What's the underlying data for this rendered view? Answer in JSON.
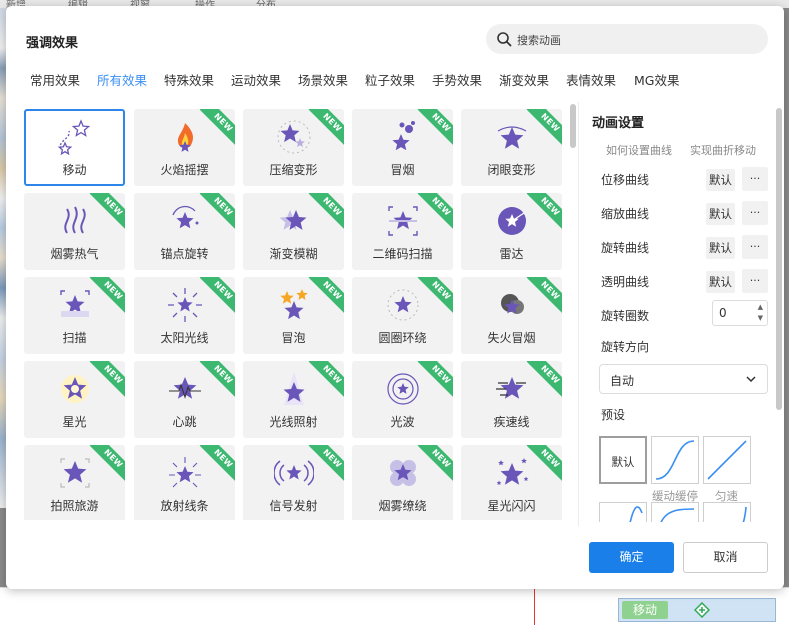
{
  "background_app": {
    "top_labels": [
      "新增",
      "编辑",
      "视窗",
      "操作",
      "分布"
    ],
    "track_clip_label": "移动"
  },
  "dialog": {
    "title": "强调效果",
    "search_placeholder": "搜索动画",
    "tabs": [
      "常用效果",
      "所有效果",
      "特殊效果",
      "运动效果",
      "场景效果",
      "粒子效果",
      "手势效果",
      "渐变效果",
      "表情效果",
      "MG效果"
    ],
    "active_tab": "所有效果",
    "effects": [
      {
        "label": "移动",
        "icon": "move-path-icon",
        "new": false,
        "selected": true
      },
      {
        "label": "火焰摇摆",
        "icon": "flame-icon",
        "new": true
      },
      {
        "label": "压缩变形",
        "icon": "compress-star-icon",
        "new": true
      },
      {
        "label": "冒烟",
        "icon": "smoke-bubbles-icon",
        "new": true
      },
      {
        "label": "闭眼变形",
        "icon": "eye-star-icon",
        "new": true
      },
      {
        "label": "烟雾热气",
        "icon": "steam-icon",
        "new": true
      },
      {
        "label": "锚点旋转",
        "icon": "anchor-rotate-icon",
        "new": true
      },
      {
        "label": "渐变模糊",
        "icon": "blur-star-icon",
        "new": true
      },
      {
        "label": "二维码扫描",
        "icon": "qr-scan-icon",
        "new": true
      },
      {
        "label": "雷达",
        "icon": "radar-icon",
        "new": true
      },
      {
        "label": "扫描",
        "icon": "scan-star-icon",
        "new": true
      },
      {
        "label": "太阳光线",
        "icon": "sun-rays-icon",
        "new": true
      },
      {
        "label": "冒泡",
        "icon": "bubble-stars-icon",
        "new": true
      },
      {
        "label": "圆圈环绕",
        "icon": "circle-orbit-icon",
        "new": true
      },
      {
        "label": "失火冒烟",
        "icon": "fire-smoke-icon",
        "new": true
      },
      {
        "label": "星光",
        "icon": "glow-star-icon",
        "new": true
      },
      {
        "label": "心跳",
        "icon": "heartbeat-star-icon",
        "new": true
      },
      {
        "label": "光线照射",
        "icon": "spotlight-star-icon",
        "new": true
      },
      {
        "label": "光波",
        "icon": "light-wave-icon",
        "new": true
      },
      {
        "label": "疾速线",
        "icon": "speed-lines-icon",
        "new": true
      },
      {
        "label": "拍照旅游",
        "icon": "photo-star-icon",
        "new": true
      },
      {
        "label": "放射线条",
        "icon": "radiate-lines-icon",
        "new": true
      },
      {
        "label": "信号发射",
        "icon": "signal-star-icon",
        "new": true
      },
      {
        "label": "烟雾缭绕",
        "icon": "smoke-flower-icon",
        "new": true
      },
      {
        "label": "星光闪闪",
        "icon": "sparkle-stars-icon",
        "new": true
      }
    ],
    "new_badge": "NEW",
    "panel": {
      "title": "动画设置",
      "link_how": "如何设置曲线",
      "link_path": "实现曲折移动",
      "curves": [
        {
          "label": "位移曲线",
          "button": "默认",
          "more": "..."
        },
        {
          "label": "缩放曲线",
          "button": "默认",
          "more": "..."
        },
        {
          "label": "旋转曲线",
          "button": "默认",
          "more": "..."
        },
        {
          "label": "透明曲线",
          "button": "默认",
          "more": "..."
        }
      ],
      "rotate_count_label": "旋转圈数",
      "rotate_count_value": "0",
      "rotate_dir_label": "旋转方向",
      "rotate_dir_value": "自动",
      "preset_label": "预设",
      "presets": [
        {
          "label": "默认",
          "caption": ""
        },
        {
          "label": "",
          "caption": "缓动缓停"
        },
        {
          "label": "",
          "caption": "匀速"
        }
      ]
    },
    "ok_label": "确定",
    "cancel_label": "取消",
    "accent_color": "#1a7fe8",
    "icon_color": "#6a55b9",
    "badge_color": "#3cb870"
  }
}
